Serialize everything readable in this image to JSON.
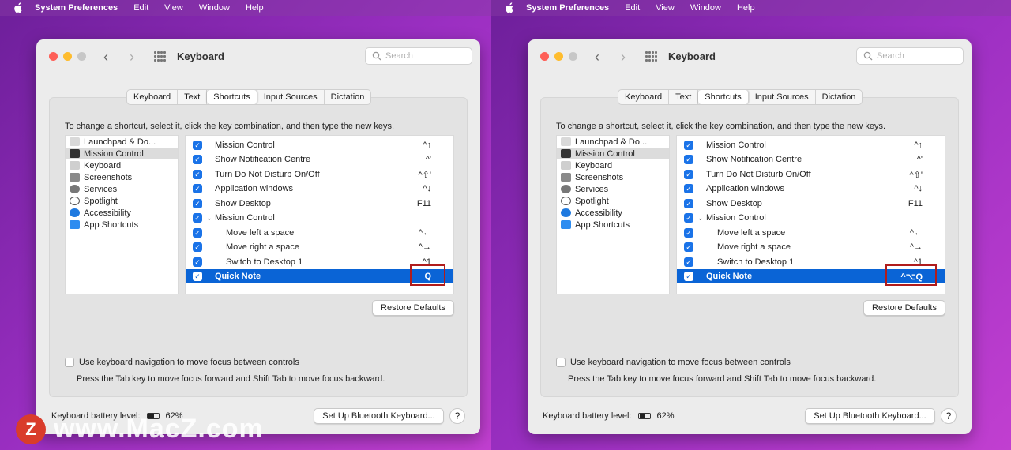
{
  "menubar": {
    "app_name": "System Preferences",
    "items": [
      "Edit",
      "View",
      "Window",
      "Help"
    ]
  },
  "window": {
    "title": "Keyboard",
    "search_placeholder": "Search"
  },
  "tabs": [
    "Keyboard",
    "Text",
    "Shortcuts",
    "Input Sources",
    "Dictation"
  ],
  "active_tab": "Shortcuts",
  "instructions": "To change a shortcut, select it, click the key combination, and then type the new keys.",
  "categories": [
    {
      "label": "Launchpad & Do...",
      "icon": "launchpad-icon"
    },
    {
      "label": "Mission Control",
      "icon": "mission-control-icon"
    },
    {
      "label": "Keyboard",
      "icon": "keyboard-icon"
    },
    {
      "label": "Screenshots",
      "icon": "screenshots-icon"
    },
    {
      "label": "Services",
      "icon": "gear-icon"
    },
    {
      "label": "Spotlight",
      "icon": "spotlight-icon"
    },
    {
      "label": "Accessibility",
      "icon": "accessibility-icon"
    },
    {
      "label": "App Shortcuts",
      "icon": "app-store-icon"
    }
  ],
  "shortcuts_left": [
    {
      "label": "Mission Control",
      "key": "^↑"
    },
    {
      "label": "Show Notification Centre",
      "key": "^'"
    },
    {
      "label": "Turn Do Not Disturb On/Off",
      "key": "^⇧'"
    },
    {
      "label": "Application windows",
      "key": "^↓"
    },
    {
      "label": "Show Desktop",
      "key": "F11"
    },
    {
      "label": "Mission Control",
      "key": ""
    },
    {
      "label": "Move left a space",
      "key": "^←"
    },
    {
      "label": "Move right a space",
      "key": "^→"
    },
    {
      "label": "Switch to Desktop 1",
      "key": "^1"
    },
    {
      "label": "Quick Note",
      "key": "Q"
    }
  ],
  "shortcuts_right": [
    {
      "label": "Mission Control",
      "key": "^↑"
    },
    {
      "label": "Show Notification Centre",
      "key": "^'"
    },
    {
      "label": "Turn Do Not Disturb On/Off",
      "key": "^⇧'"
    },
    {
      "label": "Application windows",
      "key": "^↓"
    },
    {
      "label": "Show Desktop",
      "key": "F11"
    },
    {
      "label": "Mission Control",
      "key": ""
    },
    {
      "label": "Move left a space",
      "key": "^←"
    },
    {
      "label": "Move right a space",
      "key": "^→"
    },
    {
      "label": "Switch to Desktop 1",
      "key": "^1"
    },
    {
      "label": "Quick Note",
      "key": "^⌥Q"
    }
  ],
  "restore_defaults": "Restore Defaults",
  "kb_nav_label": "Use keyboard navigation to move focus between controls",
  "kb_nav_hint": "Press the Tab key to move focus forward and Shift Tab to move focus backward.",
  "battery": {
    "label": "Keyboard battery level:",
    "value": "62%",
    "level": 0.62
  },
  "setup_bluetooth": "Set Up Bluetooth Keyboard...",
  "help": "?",
  "watermark": {
    "logo_letter": "Z",
    "text": "www.MacZ.com"
  }
}
